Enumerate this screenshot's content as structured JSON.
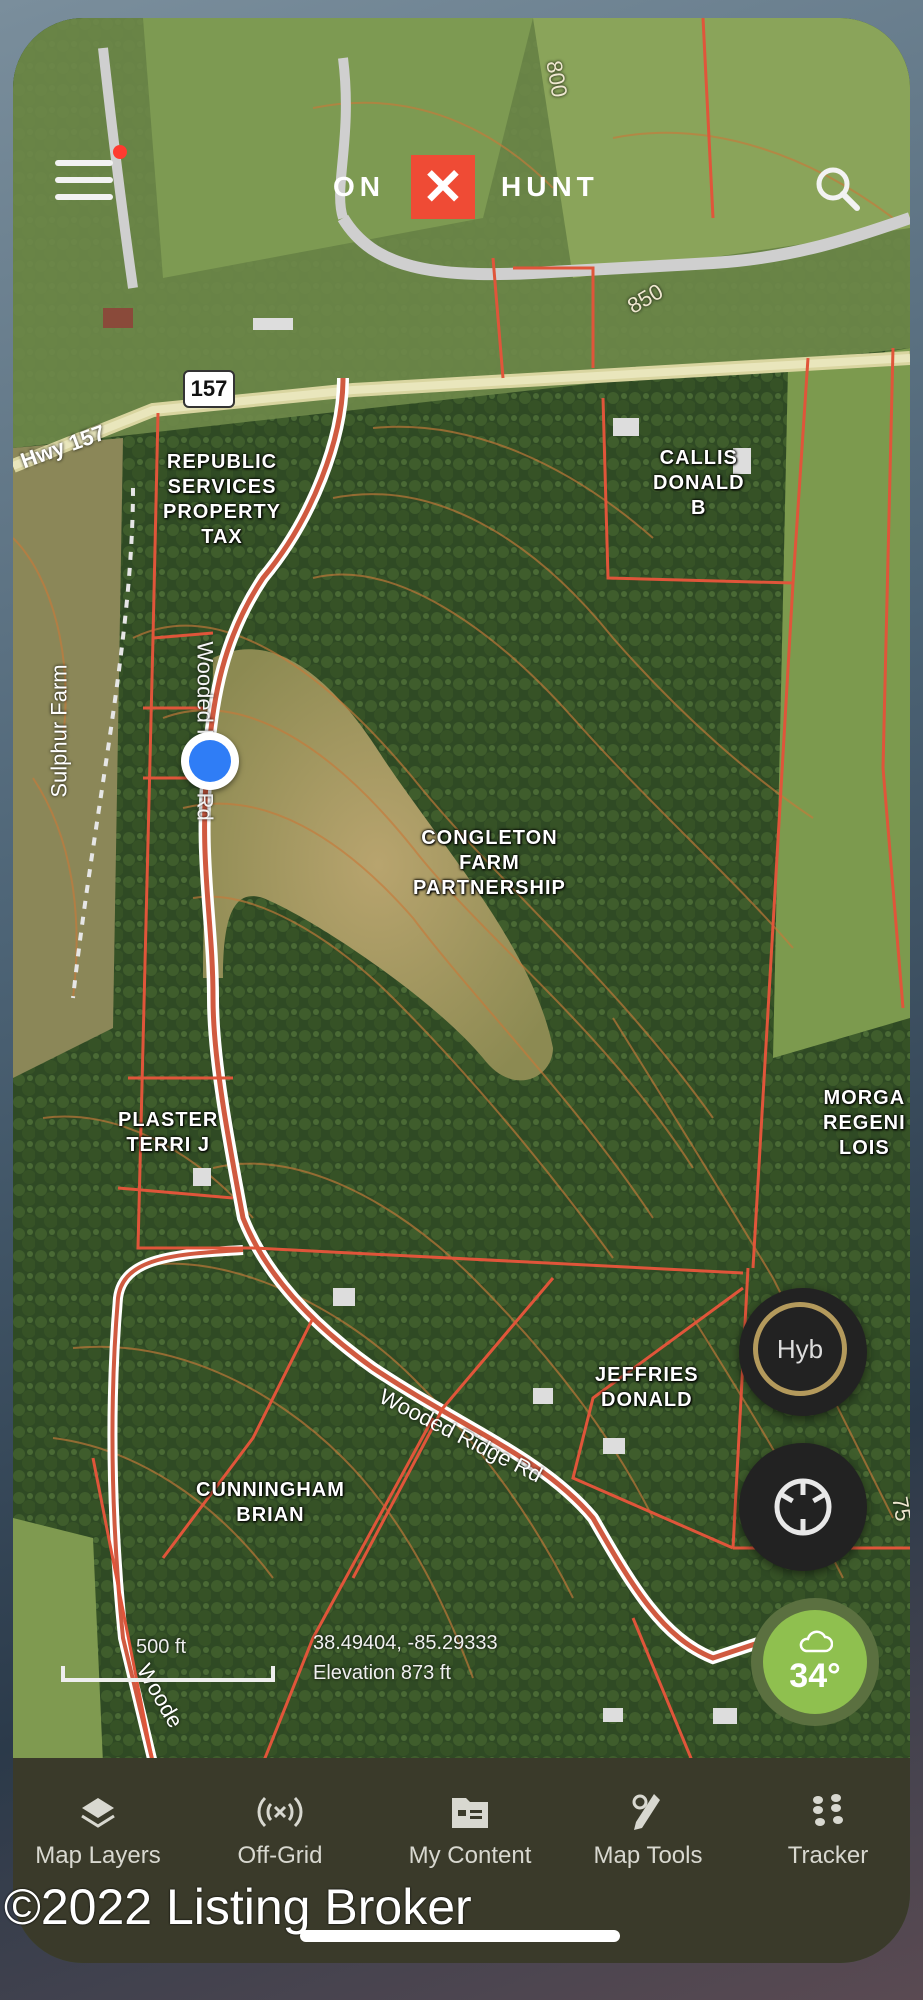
{
  "header": {
    "logo_left": "ON",
    "logo_mark": "✕",
    "logo_right": "HUNT"
  },
  "map": {
    "parcels": [
      {
        "id": "republic",
        "text": "REPUBLIC\nSERVICES\nPROPERTY\nTAX"
      },
      {
        "id": "callis",
        "text": "CALLIS\nDONALD\nB"
      },
      {
        "id": "congleton",
        "text": "CONGLETON\nFARM\nPARTNERSHIP"
      },
      {
        "id": "plaster",
        "text": "PLASTER\nTERRI J"
      },
      {
        "id": "morgan",
        "text": "MORGA\nREGENI\nLOIS"
      },
      {
        "id": "jeffries",
        "text": "JEFFRIES\nDONALD"
      },
      {
        "id": "cunningham",
        "text": "CUNNINGHAM\nBRIAN"
      }
    ],
    "roads": {
      "hwy": "Hwy 157",
      "shield": "157",
      "sulphur": "Sulphur Farm",
      "wooded1": "Wooded Ridge Rd",
      "wooded2": "Wooded Ridge Rd",
      "wooded3": "Woode",
      "elev_850": "850",
      "elev_800": "800",
      "edge_75": "75"
    },
    "scale_label": "500 ft",
    "coordinates": "38.49404, -85.29333",
    "elevation": "Elevation 873 ft"
  },
  "controls": {
    "layer_button": "Hyb",
    "temperature": "34°"
  },
  "tabs": [
    {
      "label": "Map Layers",
      "icon": "layers-icon"
    },
    {
      "label": "Off-Grid",
      "icon": "off-grid-icon"
    },
    {
      "label": "My Content",
      "icon": "folder-icon"
    },
    {
      "label": "Map Tools",
      "icon": "map-tools-icon"
    },
    {
      "label": "Tracker",
      "icon": "tracker-icon"
    }
  ],
  "watermark": "©2022 Listing Broker",
  "colors": {
    "brand": "#ef4b35",
    "boundary": "#d9553a",
    "location_dot": "#2f7df6",
    "weather": "#8fc04f"
  }
}
